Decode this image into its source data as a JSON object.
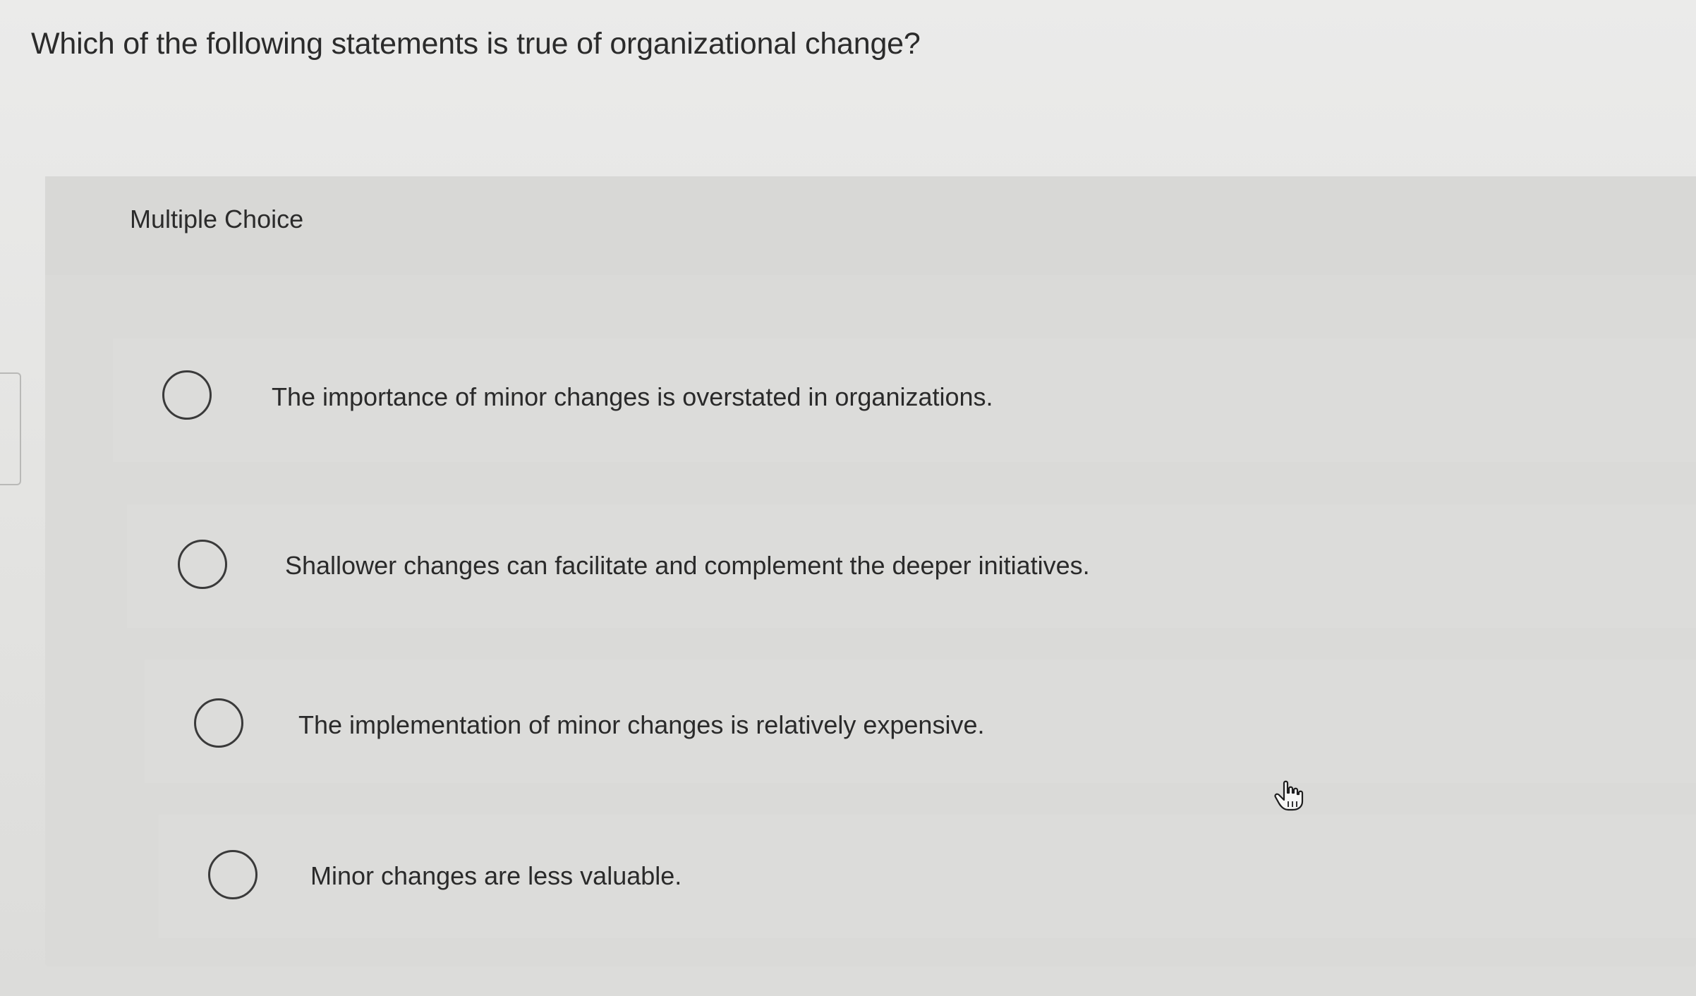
{
  "question": {
    "text": "Which of the following statements is true of organizational change?"
  },
  "card": {
    "label": "Multiple Choice"
  },
  "options": [
    {
      "label": "The importance of minor changes is overstated in organizations.",
      "selected": false
    },
    {
      "label": "Shallower changes can facilitate and complement the deeper initiatives.",
      "selected": false
    },
    {
      "label": "The implementation of minor changes is relatively expensive.",
      "selected": false
    },
    {
      "label": "Minor changes are less valuable.",
      "selected": false
    }
  ],
  "icons": {
    "radio": "radio-unchecked-icon",
    "cursor": "hand-pointer-icon"
  }
}
